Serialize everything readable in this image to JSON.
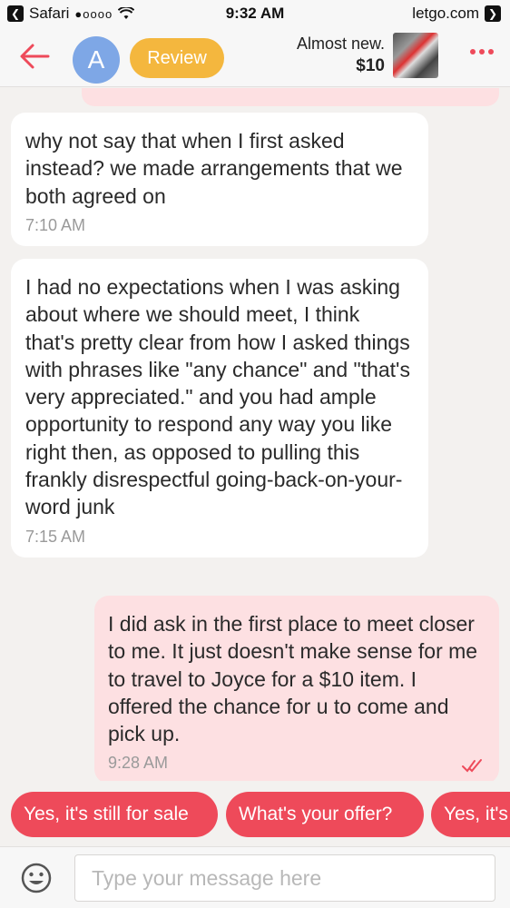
{
  "status_bar": {
    "carrier": "Safari",
    "signal": "●oooo",
    "time": "9:32 AM",
    "back_app": "letgo.com"
  },
  "header": {
    "avatar_letter": "A",
    "review_label": "Review",
    "product_title": "Almost new.",
    "product_price": "$10"
  },
  "messages": [
    {
      "direction": "incoming",
      "text": "why not say that when I first asked instead? we made arrangements that we both agreed on",
      "time": "7:10 AM"
    },
    {
      "direction": "incoming",
      "text": "I had no expectations when I was asking about where we should meet, I think that's pretty clear from how I asked things with phrases like \"any chance\" and \"that's very appreciated.\" and you had ample opportunity to respond any way you like right then, as opposed to pulling this frankly disrespectful going-back-on-your-word junk",
      "time": "7:15 AM"
    },
    {
      "direction": "outgoing",
      "text": "I did ask in the first place to meet closer to me. It just doesn't make sense for me to travel to Joyce for a $10 item. I offered the chance for u to come and pick up.",
      "time": "9:28 AM",
      "read": true
    }
  ],
  "quick_replies": [
    "Yes, it's still for sale",
    "What's your offer?",
    "Yes, it's"
  ],
  "input": {
    "placeholder": "Type your message here"
  },
  "colors": {
    "accent": "#ee4a5a",
    "review": "#f4b73e",
    "avatar": "#7ea7e6",
    "outgoing_bubble": "#fde0e2",
    "incoming_bubble": "#ffffff"
  },
  "icons": [
    "back-arrow-icon",
    "more-dots-icon",
    "double-check-icon",
    "emoji-icon",
    "wifi-icon"
  ]
}
